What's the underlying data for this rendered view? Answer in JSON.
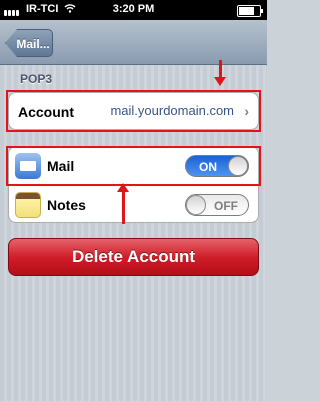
{
  "status_bar": {
    "carrier": "IR-TCI",
    "time": "3:20 PM",
    "battery_level_percent": 85,
    "signal_icon": "signal-bars-icon",
    "wifi_icon": "wifi-icon",
    "battery_icon": "battery-icon"
  },
  "nav": {
    "back_label": "Mail..."
  },
  "section": {
    "title": "POP3"
  },
  "account": {
    "label": "Account",
    "value": "mail.yourdomain.com",
    "chevron": "›"
  },
  "services": [
    {
      "label": "Mail",
      "icon": "mail-app-icon",
      "toggle_state": "ON"
    },
    {
      "label": "Notes",
      "icon": "notes-app-icon",
      "toggle_state": "OFF"
    }
  ],
  "delete_button": {
    "label": "Delete Account"
  },
  "colors": {
    "annotation_red": "#e1141c",
    "toggle_on_blue": "#1a62d6",
    "delete_red": "#cf1f2a",
    "link_blue": "#385487"
  }
}
